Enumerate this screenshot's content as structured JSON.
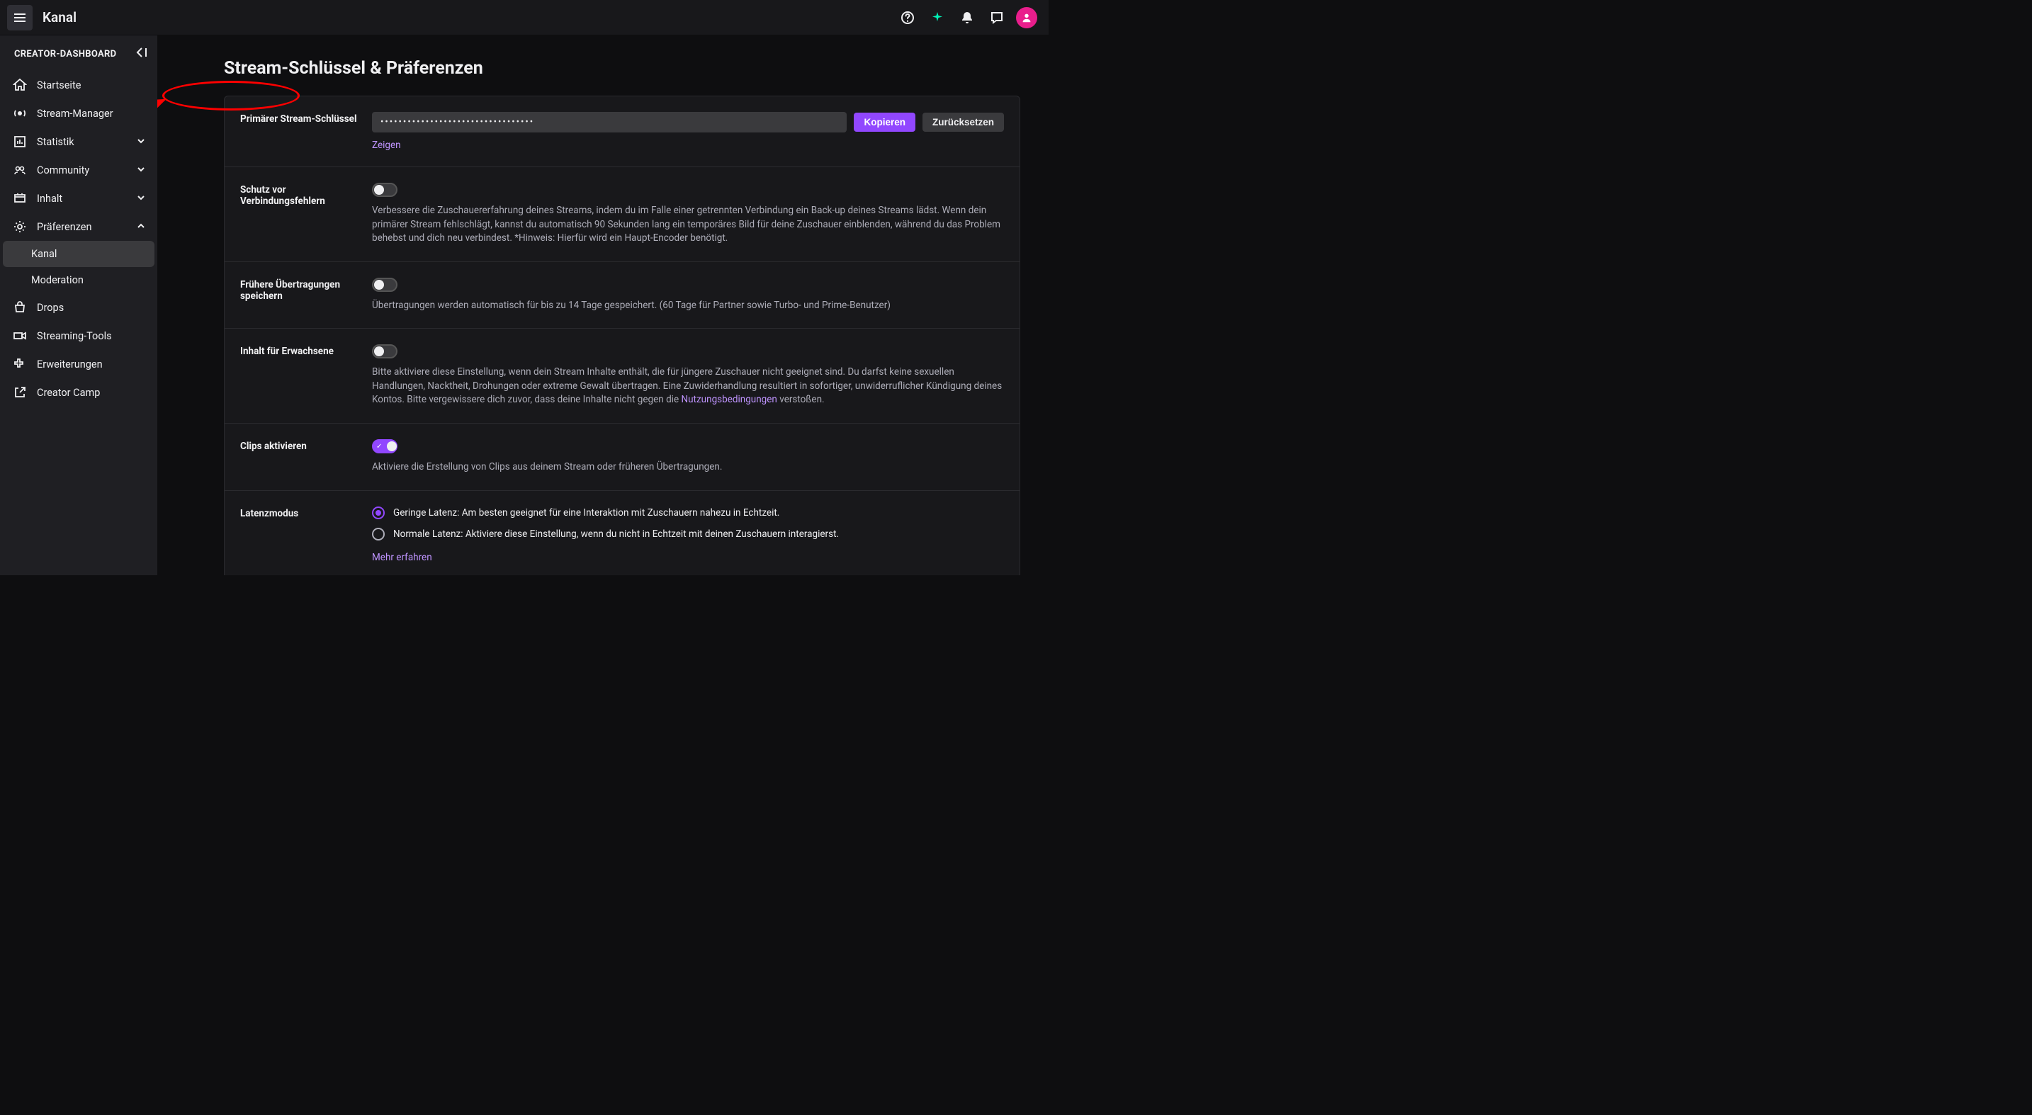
{
  "topbar": {
    "title": "Kanal"
  },
  "sidebar": {
    "header": "CREATOR-DASHBOARD",
    "items": [
      {
        "label": "Startseite"
      },
      {
        "label": "Stream-Manager"
      },
      {
        "label": "Statistik"
      },
      {
        "label": "Community"
      },
      {
        "label": "Inhalt"
      },
      {
        "label": "Präferenzen"
      },
      {
        "label": "Drops"
      },
      {
        "label": "Streaming-Tools"
      },
      {
        "label": "Erweiterungen"
      },
      {
        "label": "Creator Camp"
      }
    ],
    "subitems": {
      "kanal": "Kanal",
      "moderation": "Moderation"
    }
  },
  "page": {
    "title": "Stream-Schlüssel & Präferenzen",
    "streamkey": {
      "label": "Primärer Stream-Schlüssel",
      "value": "••••••••••••••••••••••••••••••••••",
      "copy": "Kopieren",
      "reset": "Zurücksetzen",
      "show": "Zeigen"
    },
    "disconnect": {
      "label": "Schutz vor Verbindungsfehlern",
      "desc": "Verbessere die Zuschauererfahrung deines Streams, indem du im Falle einer getrennten Verbindung ein Back-up deines Streams lädst. Wenn dein primärer Stream fehlschlägt, kannst du automatisch 90 Sekunden lang ein temporäres Bild für deine Zuschauer einblenden, während du das Problem behebst und dich neu verbindest. *Hinweis: Hierfür wird ein Haupt-Encoder benötigt."
    },
    "vod": {
      "label": "Frühere Übertragungen speichern",
      "desc": "Übertragungen werden automatisch für bis zu 14 Tage gespeichert. (60 Tage für Partner sowie Turbo- und Prime-Benutzer)"
    },
    "mature": {
      "label": "Inhalt für Erwachsene",
      "desc_pre": "Bitte aktiviere diese Einstellung, wenn dein Stream Inhalte enthält, die für jüngere Zuschauer nicht geeignet sind. Du darfst keine sexuellen Handlungen, Nacktheit, Drohungen oder extreme Gewalt übertragen. Eine Zuwiderhandlung resultiert in sofortiger, unwiderruflicher Kündigung deines Kontos. Bitte vergewissere dich zuvor, dass deine Inhalte nicht gegen die ",
      "tos": "Nutzungsbedingungen",
      "desc_post": " verstoßen."
    },
    "clips": {
      "label": "Clips aktivieren",
      "desc": "Aktiviere die Erstellung von Clips aus deinem Stream oder früheren Übertragungen."
    },
    "latency": {
      "label": "Latenzmodus",
      "low": "Geringe Latenz: Am besten geeignet für eine Interaktion mit Zuschauern nahezu in Echtzeit.",
      "normal": "Normale Latenz: Aktiviere diese Einstellung, wenn du nicht in Echtzeit mit deinen Zuschauern interagierst.",
      "more": "Mehr erfahren"
    }
  }
}
